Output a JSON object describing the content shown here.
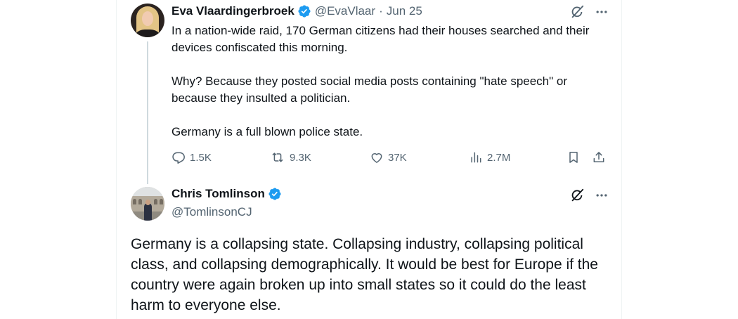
{
  "colors": {
    "text_primary": "#0f1419",
    "text_secondary": "#536471",
    "verified_blue": "#1d9bf0",
    "thread_line": "#cfd9de"
  },
  "parent_tweet": {
    "author": {
      "display_name": "Eva Vlaardingerbroek",
      "handle": "@EvaVlaar",
      "verified": true
    },
    "date": "Jun 25",
    "separator": "·",
    "text": {
      "p1": "In a nation-wide raid, 170 German citizens had their houses searched and their devices confiscated this morning.",
      "p2": "Why? Because they posted social media posts containing \"hate speech\" or because they insulted a politician.",
      "p3": "Germany is a full blown police state."
    },
    "stats": {
      "replies": "1.5K",
      "reposts": "9.3K",
      "likes": "37K",
      "views": "2.7M"
    },
    "icons": [
      "grok-icon",
      "more-icon",
      "reply-icon",
      "repost-icon",
      "like-icon",
      "views-icon",
      "bookmark-icon",
      "share-icon"
    ]
  },
  "reply_tweet": {
    "author": {
      "display_name": "Chris Tomlinson",
      "handle": "@TomlinsonCJ",
      "verified": true
    },
    "text": "Germany is a collapsing state. Collapsing industry, collapsing political class, and collapsing demographically. It would be best for Europe if the country were again broken up into small states so it could do the least harm to everyone else.",
    "icons": [
      "grok-icon",
      "more-icon"
    ]
  }
}
